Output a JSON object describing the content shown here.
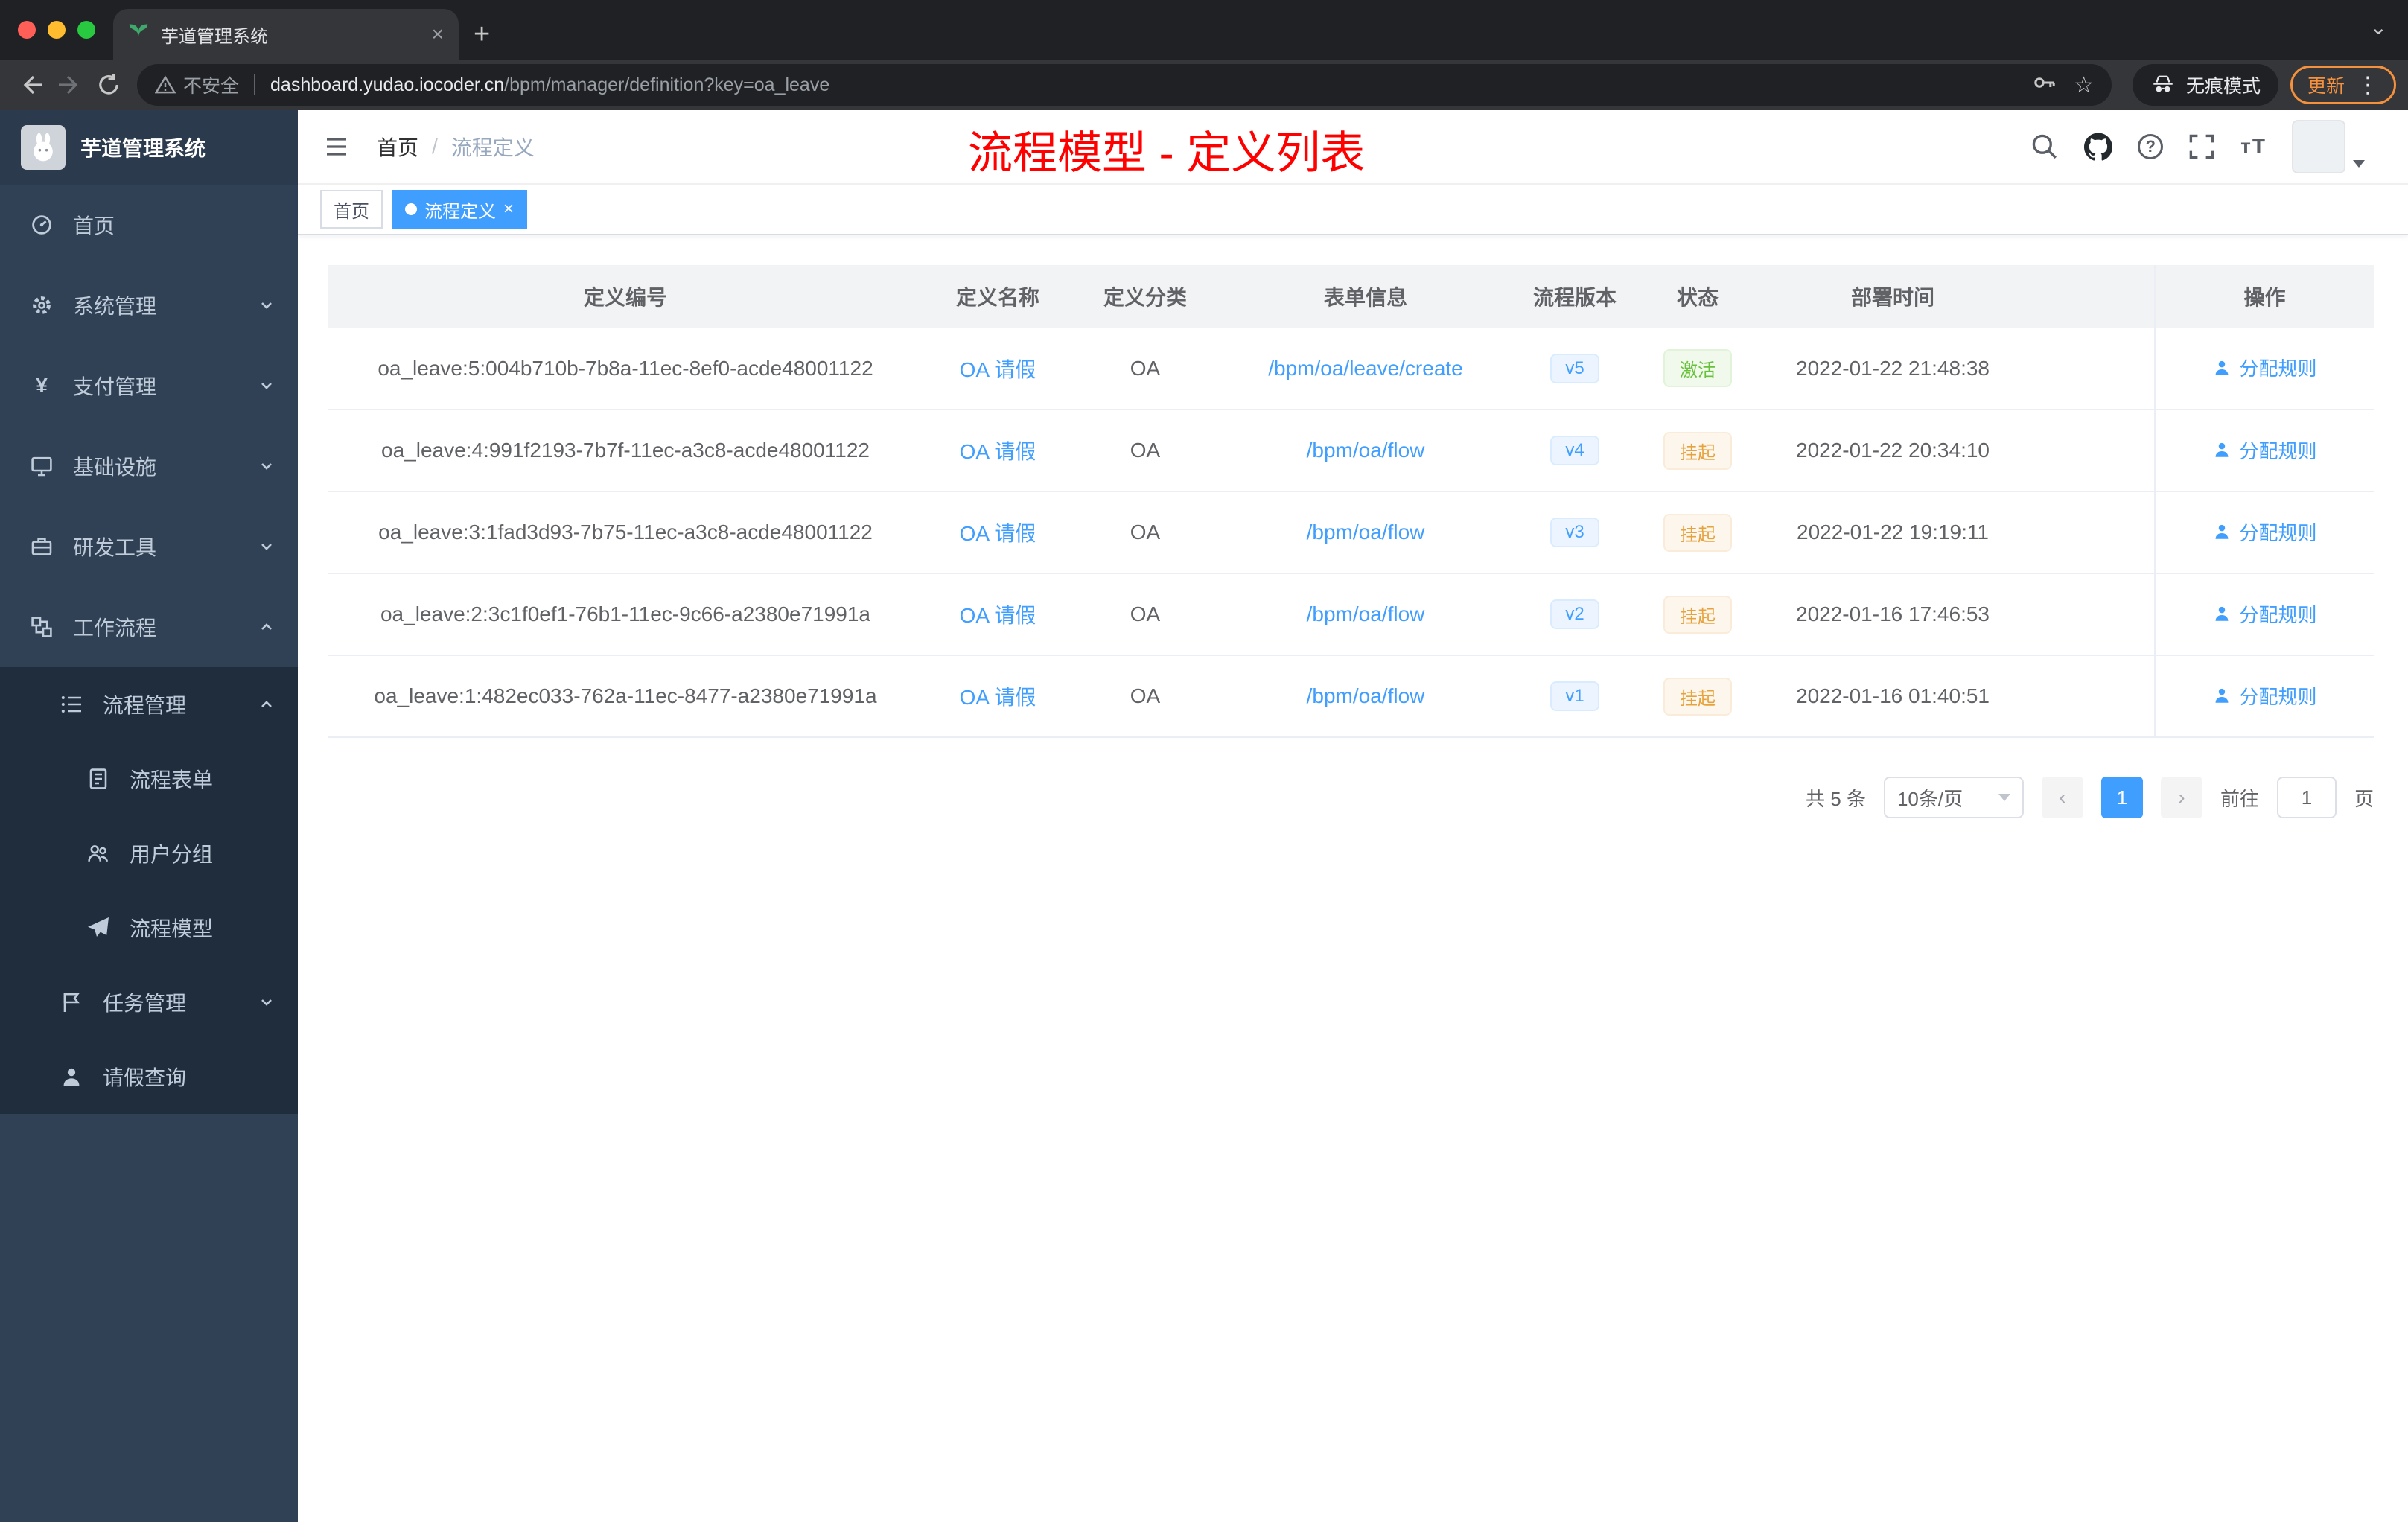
{
  "browser": {
    "tab_title": "芋道管理系统",
    "tab_close": "×",
    "new_tab": "+",
    "tab_search": "⌄",
    "security_label": "不安全",
    "url_host": "dashboard.yudao.iocoder.cn",
    "url_path": "/bpm/manager/definition?key=oa_leave",
    "star": "☆",
    "incognito_label": "无痕模式",
    "update_label": "更新",
    "menu_dots": "⋮"
  },
  "sidebar": {
    "app_title": "芋道管理系统",
    "items": [
      {
        "label": "首页"
      },
      {
        "label": "系统管理"
      },
      {
        "label": "支付管理"
      },
      {
        "label": "基础设施"
      },
      {
        "label": "研发工具"
      },
      {
        "label": "工作流程"
      },
      {
        "label": "流程管理"
      },
      {
        "label": "流程表单"
      },
      {
        "label": "用户分组"
      },
      {
        "label": "流程模型"
      },
      {
        "label": "任务管理"
      },
      {
        "label": "请假查询"
      }
    ]
  },
  "header": {
    "breadcrumb_home": "首页",
    "breadcrumb_separator": "/",
    "breadcrumb_current": "流程定义",
    "annotation": "流程模型 - 定义列表",
    "fontsize_icon_label": "тT"
  },
  "tags": {
    "home": "首页",
    "current": "流程定义",
    "close": "×"
  },
  "table": {
    "columns": [
      "定义编号",
      "定义名称",
      "定义分类",
      "表单信息",
      "流程版本",
      "状态",
      "部署时间",
      "操作"
    ],
    "action_label": "分配规则",
    "rows": [
      {
        "id": "oa_leave:5:004b710b-7b8a-11ec-8ef0-acde48001122",
        "name": "OA 请假",
        "category": "OA",
        "form": "/bpm/oa/leave/create",
        "version": "v5",
        "status": "激活",
        "status_type": "success",
        "time": "2022-01-22 21:48:38"
      },
      {
        "id": "oa_leave:4:991f2193-7b7f-11ec-a3c8-acde48001122",
        "name": "OA 请假",
        "category": "OA",
        "form": "/bpm/oa/flow",
        "version": "v4",
        "status": "挂起",
        "status_type": "warning",
        "time": "2022-01-22 20:34:10"
      },
      {
        "id": "oa_leave:3:1fad3d93-7b75-11ec-a3c8-acde48001122",
        "name": "OA 请假",
        "category": "OA",
        "form": "/bpm/oa/flow",
        "version": "v3",
        "status": "挂起",
        "status_type": "warning",
        "time": "2022-01-22 19:19:11"
      },
      {
        "id": "oa_leave:2:3c1f0ef1-76b1-11ec-9c66-a2380e71991a",
        "name": "OA 请假",
        "category": "OA",
        "form": "/bpm/oa/flow",
        "version": "v2",
        "status": "挂起",
        "status_type": "warning",
        "time": "2022-01-16 17:46:53"
      },
      {
        "id": "oa_leave:1:482ec033-762a-11ec-8477-a2380e71991a",
        "name": "OA 请假",
        "category": "OA",
        "form": "/bpm/oa/flow",
        "version": "v1",
        "status": "挂起",
        "status_type": "warning",
        "time": "2022-01-16 01:40:51"
      }
    ]
  },
  "pagination": {
    "total": "共 5 条",
    "page_size": "10条/页",
    "prev": "‹",
    "current_page": "1",
    "next": "›",
    "goto": "前往",
    "goto_value": "1",
    "unit": "页"
  },
  "colors": {
    "accent": "#409eff",
    "success": "#67c23a",
    "warning": "#e6a23c",
    "annotation": "#ff0000",
    "sidebar_bg": "#304156",
    "submenu_bg": "#1f2d3d"
  }
}
